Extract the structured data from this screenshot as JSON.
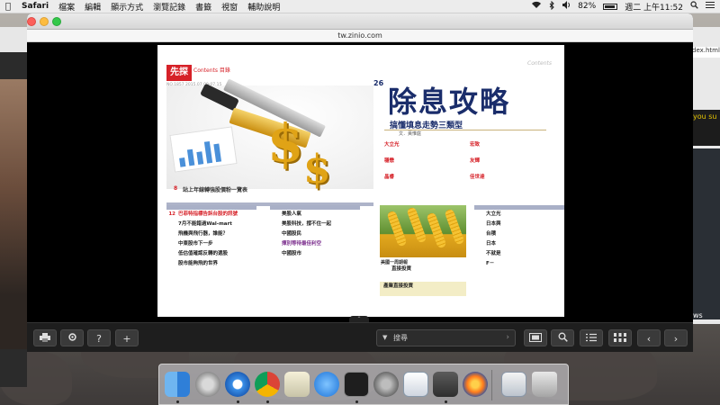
{
  "menubar": {
    "apple": "",
    "app_name": "Safari",
    "items": [
      "檔案",
      "編輯",
      "顯示方式",
      "瀏覽記錄",
      "書籤",
      "視窗",
      "輔助說明"
    ],
    "battery_percent": "82%",
    "battery_level": 0.82,
    "clock": "週二 上午11:52"
  },
  "browser": {
    "url": "tw.zinio.com",
    "bg_right_url": "dex.html.c",
    "bg_right_text": "you su",
    "bg_right_text2": "ws"
  },
  "magazine": {
    "brand": "先探",
    "brand_sub": "Contents 目錄",
    "brand_meta": "NO.1857  2015.07.09-07.15",
    "contents_tag": "Contents",
    "cover_story": {
      "page": "26",
      "title": "除息攻略",
      "subtitle": "搞懂填息走勢三類型",
      "author": "文．黃惟庭",
      "illus_page": "8",
      "illus_caption": "站上年線轉強股價粉一覽表",
      "subitems": [
        {
          "title": "大立光",
          "desc": ""
        },
        {
          "title": "宏致",
          "desc": ""
        },
        {
          "title": "穩懋",
          "desc": ""
        },
        {
          "title": "友輝",
          "desc": ""
        },
        {
          "title": "晶睿",
          "desc": ""
        },
        {
          "title": "佳世達",
          "desc": ""
        }
      ]
    },
    "col1": [
      {
        "page": "12",
        "title": "巴菲特指標告訴台股的訊號",
        "desc": "",
        "cls": "red"
      },
      {
        "page": "",
        "title": "7月不能錯過Wal-mart",
        "desc": "",
        "cls": ""
      },
      {
        "page": "",
        "title": "飛機與飛行器，誰能？",
        "desc": "",
        "cls": ""
      },
      {
        "page": "",
        "title": "中東股市下一步",
        "desc": "",
        "cls": ""
      },
      {
        "page": "",
        "title": "低估值確認反轉的選股",
        "desc": "",
        "cls": ""
      },
      {
        "page": "",
        "title": "股市能夠飛的世界",
        "desc": "",
        "cls": ""
      }
    ],
    "col2": [
      {
        "page": "",
        "title": "美股人氣",
        "desc": "",
        "cls": ""
      },
      {
        "page": "",
        "title": "美股科技，撐不住一起",
        "desc": "",
        "cls": ""
      },
      {
        "page": "",
        "title": "中國股民",
        "desc": "",
        "cls": ""
      },
      {
        "page": "",
        "title": "揮別等待最佳利空",
        "desc": "",
        "cls": "purple"
      },
      {
        "page": "",
        "title": "中國股市",
        "desc": "",
        "cls": ""
      }
    ],
    "col3": [
      {
        "page": "",
        "title": "大立光",
        "desc": "",
        "cls": ""
      },
      {
        "page": "",
        "title": "日本與",
        "desc": "",
        "cls": ""
      },
      {
        "page": "",
        "title": "台積",
        "desc": "",
        "cls": ""
      },
      {
        "page": "",
        "title": "日本",
        "desc": "",
        "cls": ""
      },
      {
        "page": "",
        "title": "不就是",
        "desc": "",
        "cls": ""
      },
      {
        "page": "",
        "title": "F－",
        "desc": "",
        "cls": ""
      }
    ],
    "corn": {
      "caption": "美國一周期報",
      "items": [
        {
          "page": "",
          "title": "直接投資",
          "desc": "",
          "cls": ""
        }
      ],
      "highlight": "產業直接投資"
    }
  },
  "toolbar": {
    "print_icon": "print-icon",
    "settings_icon": "gear-icon",
    "help_label": "?",
    "add_label": "+",
    "search_placeholder": "搜尋",
    "search_arrow": "›",
    "handle": "⌃"
  },
  "dock": {
    "apps": [
      "Finder",
      "Launchpad",
      "Safari",
      "Chrome",
      "Preview",
      "App Store",
      "Terminal",
      "System Preferences",
      "TextWrangler",
      "Sublime Text",
      "Firefox",
      "Documents",
      "Trash"
    ]
  }
}
